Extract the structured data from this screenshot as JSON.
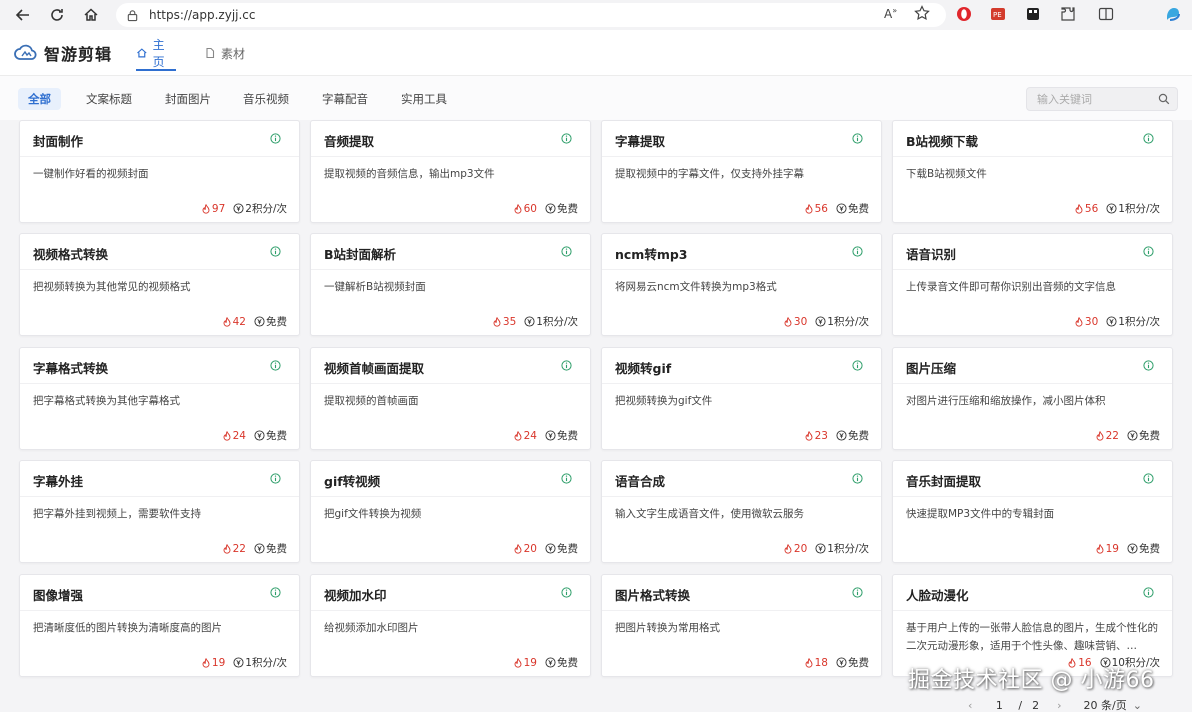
{
  "browser": {
    "url": "https://app.zyjj.cc",
    "tools": [
      "read-aloud",
      "favorite",
      "opera",
      "pdf",
      "collection",
      "extensions",
      "split",
      "profile"
    ]
  },
  "header": {
    "app_title": "智游剪辑",
    "tabs": [
      {
        "label": "主页",
        "active": true
      },
      {
        "label": "素材",
        "active": false
      }
    ]
  },
  "categories": [
    {
      "label": "全部",
      "active": true
    },
    {
      "label": "文案标题",
      "active": false
    },
    {
      "label": "封面图片",
      "active": false
    },
    {
      "label": "音乐视频",
      "active": false
    },
    {
      "label": "字幕配音",
      "active": false
    },
    {
      "label": "实用工具",
      "active": false
    }
  ],
  "search": {
    "placeholder": "输入关键词"
  },
  "cards": [
    {
      "title": "封面制作",
      "desc": "一键制作好看的视频封面",
      "hot": "97",
      "price": "2积分/次"
    },
    {
      "title": "音频提取",
      "desc": "提取视频的音频信息，输出mp3文件",
      "hot": "60",
      "price": "免费"
    },
    {
      "title": "字幕提取",
      "desc": "提取视频中的字幕文件，仅支持外挂字幕",
      "hot": "56",
      "price": "免费"
    },
    {
      "title": "B站视频下载",
      "desc": "下载B站视频文件",
      "hot": "56",
      "price": "1积分/次"
    },
    {
      "title": "视频格式转换",
      "desc": "把视频转换为其他常见的视频格式",
      "hot": "42",
      "price": "免费"
    },
    {
      "title": "B站封面解析",
      "desc": "一键解析B站视频封面",
      "hot": "35",
      "price": "1积分/次"
    },
    {
      "title": "ncm转mp3",
      "desc": "将网易云ncm文件转换为mp3格式",
      "hot": "30",
      "price": "1积分/次"
    },
    {
      "title": "语音识别",
      "desc": "上传录音文件即可帮你识别出音频的文字信息",
      "hot": "30",
      "price": "1积分/次"
    },
    {
      "title": "字幕格式转换",
      "desc": "把字幕格式转换为其他字幕格式",
      "hot": "24",
      "price": "免费"
    },
    {
      "title": "视频首帧画面提取",
      "desc": "提取视频的首帧画面",
      "hot": "24",
      "price": "免费"
    },
    {
      "title": "视频转gif",
      "desc": "把视频转换为gif文件",
      "hot": "23",
      "price": "免费"
    },
    {
      "title": "图片压缩",
      "desc": "对图片进行压缩和缩放操作，减小图片体积",
      "hot": "22",
      "price": "免费"
    },
    {
      "title": "字幕外挂",
      "desc": "把字幕外挂到视频上，需要软件支持",
      "hot": "22",
      "price": "免费"
    },
    {
      "title": "gif转视频",
      "desc": "把gif文件转换为视频",
      "hot": "20",
      "price": "免费"
    },
    {
      "title": "语音合成",
      "desc": "输入文字生成语音文件，使用微软云服务",
      "hot": "20",
      "price": "1积分/次"
    },
    {
      "title": "音乐封面提取",
      "desc": "快速提取MP3文件中的专辑封面",
      "hot": "19",
      "price": "免费"
    },
    {
      "title": "图像增强",
      "desc": "把清晰度低的图片转换为清晰度高的图片",
      "hot": "19",
      "price": "1积分/次"
    },
    {
      "title": "视频加水印",
      "desc": "给视频添加水印图片",
      "hot": "19",
      "price": "免费"
    },
    {
      "title": "图片格式转换",
      "desc": "把图片转换为常用格式",
      "hot": "18",
      "price": "免费"
    },
    {
      "title": "人脸动漫化",
      "desc": "基于用户上传的一张带人脸信息的图片，生成个性化的二次元动漫形象，适用于个性头像、趣味营销、…",
      "hot": "16",
      "price": "10积分/次"
    }
  ],
  "pagination": {
    "current": "1",
    "separator": "/",
    "total": "2",
    "page_size": "20 条/页"
  },
  "watermark": "掘金技术社区 @ 小游66",
  "colors": {
    "accent": "#2f6fd0",
    "hot": "#d9362b",
    "info": "#2e9e6a"
  }
}
